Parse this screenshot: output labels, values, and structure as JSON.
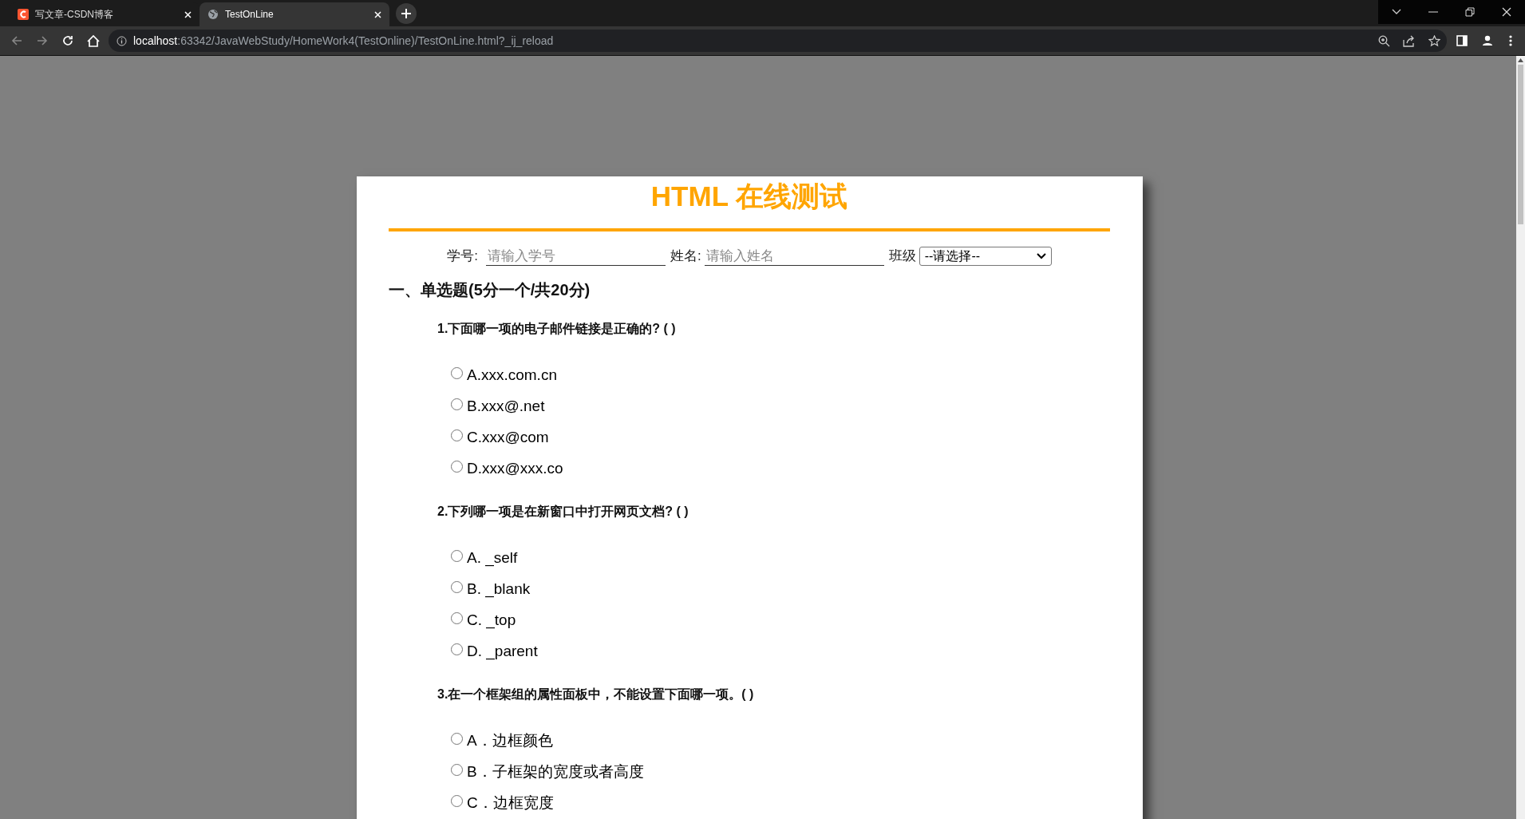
{
  "browser": {
    "tabs": [
      {
        "title": "写文章-CSDN博客",
        "kind": "csdn",
        "selected": false
      },
      {
        "title": "TestOnLine",
        "kind": "globe",
        "selected": true
      }
    ],
    "address": {
      "host": "localhost",
      "path": ":63342/JavaWebStudy/HomeWork4(TestOnline)/TestOnLine.html?_ij_reload"
    }
  },
  "page": {
    "title": "HTML 在线测试",
    "fields": [
      {
        "label": "学号:",
        "placeholder": "请输入学号"
      },
      {
        "label": "姓名:",
        "placeholder": "请输入姓名"
      }
    ],
    "select": {
      "label": "班级",
      "value": "--请选择--"
    },
    "section": "一、单选题(5分一个/共20分)",
    "questions": [
      {
        "text": "1.下面哪一项的电子邮件链接是正确的? ( )",
        "options": [
          {
            "label": "A.xxx.com.cn",
            "selected": false
          },
          {
            "label": "B.xxx@.net",
            "selected": false
          },
          {
            "label": "C.xxx@com",
            "selected": false
          },
          {
            "label": "D.xxx@xxx.co",
            "selected": false
          }
        ]
      },
      {
        "text": "2.下列哪一项是在新窗口中打开网页文档? ( )",
        "options": [
          {
            "label": "A. _self",
            "selected": false
          },
          {
            "label": "B. _blank",
            "selected": false
          },
          {
            "label": "C. _top",
            "selected": false
          },
          {
            "label": "D. _parent",
            "selected": false
          }
        ]
      },
      {
        "text": "3.在一个框架组的属性面板中，不能设置下面哪一项。( )",
        "options": [
          {
            "label": "A．边框颜色",
            "selected": false
          },
          {
            "label": "B．子框架的宽度或者高度",
            "selected": false
          },
          {
            "label": "C．边框宽度",
            "selected": false
          }
        ]
      }
    ]
  }
}
